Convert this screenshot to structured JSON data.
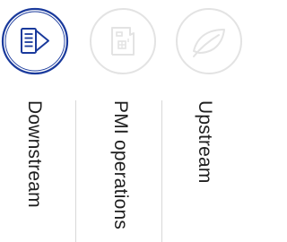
{
  "tabs": [
    {
      "label": "Downstream",
      "icon": "fuel-pump-icon",
      "active": true
    },
    {
      "label": "PMI operations",
      "icon": "factory-icon",
      "active": false
    },
    {
      "label": "Upstream",
      "icon": "leaf-icon",
      "active": false
    }
  ],
  "colors": {
    "active": "#1a3a9c",
    "inactive_icon": "#e3e3e3",
    "label": "#1f1f1f",
    "divider": "#d8d8d8"
  }
}
